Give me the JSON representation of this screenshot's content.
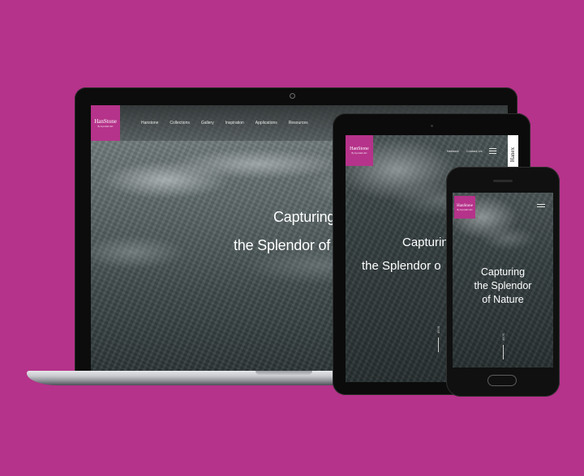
{
  "brand": {
    "name": "HanStone",
    "tagline": "By Hyundai L&C",
    "accent": "#b5338a",
    "background": "#b5338a"
  },
  "desktop": {
    "nav": [
      "Hanstone",
      "Collections",
      "Gallery",
      "Inspiration",
      "Applications",
      "Resources"
    ],
    "headline_line1": "Capturing",
    "headline_line2": "the Splendor of N"
  },
  "tablet": {
    "nav_network": "Network",
    "nav_contact": "Contact Us",
    "menu_icon": "hamburger-icon",
    "side_tab": "Hanex",
    "headline_line1": "Capturin",
    "headline_line2": "the Splendor o",
    "scroll_label": "Scroll"
  },
  "phone": {
    "menu_icon": "hamburger-icon",
    "headline_line1": "Capturing",
    "headline_line2": "the Splendor",
    "headline_line3": "of Nature",
    "scroll_label": "Scroll"
  }
}
